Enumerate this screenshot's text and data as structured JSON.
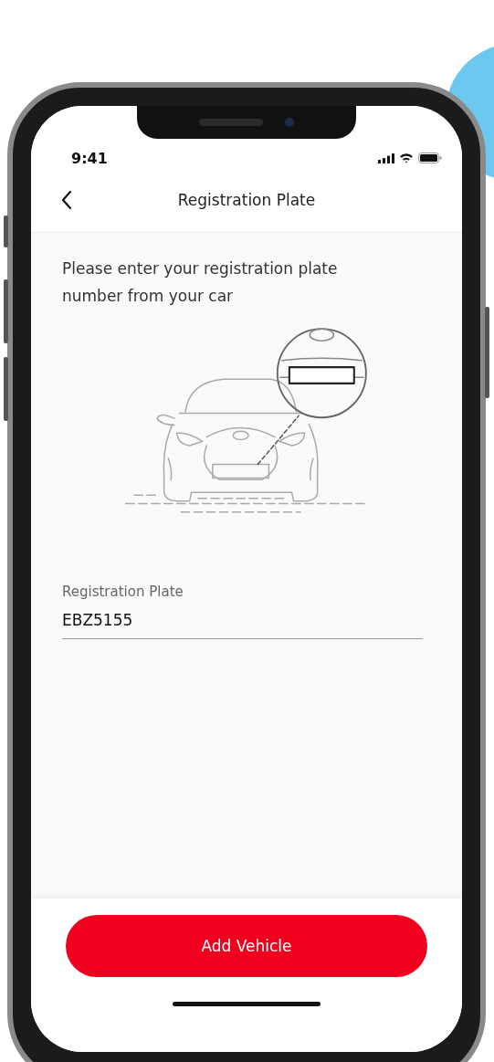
{
  "status_bar": {
    "time": "9:41"
  },
  "header": {
    "title": "Registration Plate"
  },
  "instructions": "Please enter your registration plate number from your car",
  "field": {
    "label": "Registration Plate",
    "value": "EBZ5155"
  },
  "primary_button": {
    "label": "Add Vehicle"
  }
}
